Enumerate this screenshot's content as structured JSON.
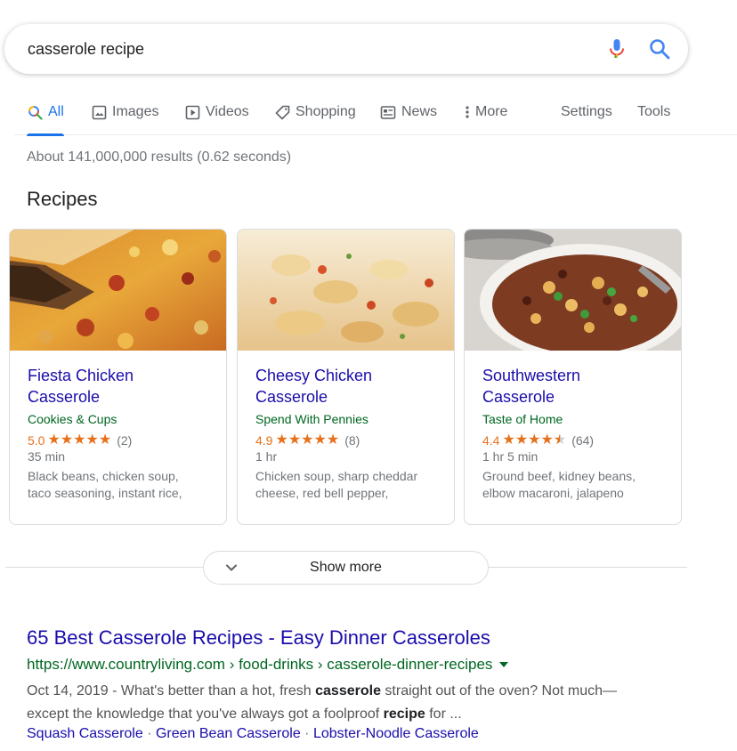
{
  "search": {
    "query": "casserole recipe"
  },
  "tabs": [
    {
      "label": "All",
      "icon": "search-color-icon",
      "active": true
    },
    {
      "label": "Images",
      "icon": "image-icon"
    },
    {
      "label": "Videos",
      "icon": "play-icon"
    },
    {
      "label": "Shopping",
      "icon": "tag-icon"
    },
    {
      "label": "News",
      "icon": "news-icon"
    },
    {
      "label": "More",
      "icon": "more-vert-icon"
    },
    {
      "label": "Settings"
    },
    {
      "label": "Tools"
    }
  ],
  "result_stats": "About 141,000,000 results (0.62 seconds)",
  "recipes": {
    "heading": "Recipes",
    "items": [
      {
        "title_line1": "Fiesta Chicken",
        "title_line2": "Casserole",
        "source": "Cookies & Cups",
        "rating": "5.0",
        "stars": 5.0,
        "reviews": "(2)",
        "time": "35 min",
        "ingredients_line1": "Black beans, chicken soup,",
        "ingredients_line2": "taco seasoning, instant rice,"
      },
      {
        "title_line1": "Cheesy Chicken",
        "title_line2": "Casserole",
        "source": "Spend With Pennies",
        "rating": "4.9",
        "stars": 4.9,
        "reviews": "(8)",
        "time": "1 hr",
        "ingredients_line1": "Chicken soup, sharp cheddar",
        "ingredients_line2": "cheese, red bell pepper,"
      },
      {
        "title_line1": "Southwestern",
        "title_line2": "Casserole",
        "source": "Taste of Home",
        "rating": "4.4",
        "stars": 4.4,
        "reviews": "(64)",
        "time": "1 hr 5 min",
        "ingredients_line1": "Ground beef, kidney beans,",
        "ingredients_line2": "elbow macaroni, jalapeno"
      }
    ],
    "show_more": "Show more"
  },
  "result": {
    "title": "65 Best Casserole Recipes - Easy Dinner Casseroles",
    "url": "https://www.countryliving.com › food-drinks › casserole-dinner-recipes",
    "date": "Oct 14, 2019",
    "snippet_a": " - What's better than a hot, fresh ",
    "snippet_bold1": "casserole",
    "snippet_b": " straight out of the oven? Not much—except the knowledge that you've always got a foolproof ",
    "snippet_bold2": "recipe",
    "snippet_c": " for ...",
    "sitelinks": [
      "Squash Casserole",
      "Green Bean Casserole",
      "Lobster-Noodle Casserole"
    ]
  },
  "colors": {
    "link": "#1a0dab",
    "url_green": "#006621",
    "accent_blue": "#1a73e8",
    "star_orange": "#e7711b"
  }
}
